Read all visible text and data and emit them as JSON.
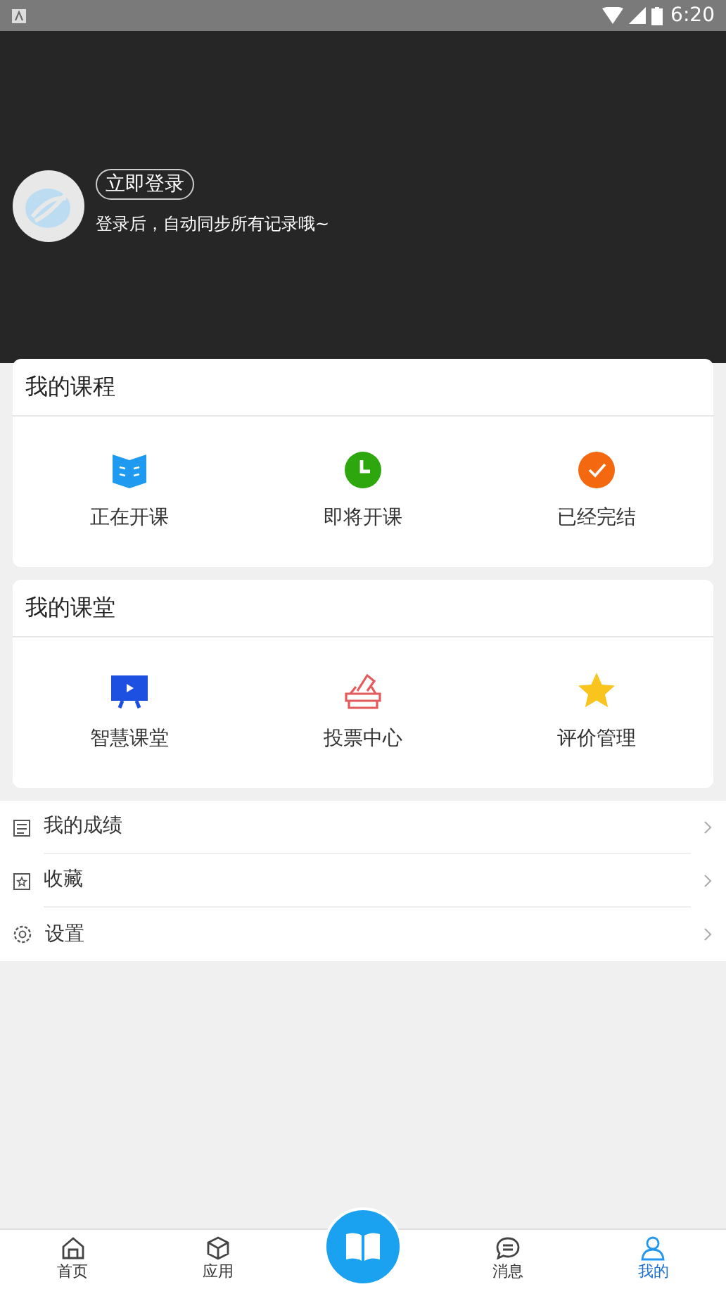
{
  "status_bar": {
    "time": "6:20"
  },
  "profile": {
    "login_button": "立即登录",
    "hint": "登录后，自动同步所有记录哦~"
  },
  "sections": [
    {
      "title": "我的课程",
      "items": [
        {
          "label": "正在开课",
          "kind": "book"
        },
        {
          "label": "即将开课",
          "kind": "clock"
        },
        {
          "label": "已经完结",
          "kind": "check"
        }
      ]
    },
    {
      "title": "我的课堂",
      "items": [
        {
          "label": "智慧课堂",
          "kind": "screen"
        },
        {
          "label": "投票中心",
          "kind": "vote"
        },
        {
          "label": "评价管理",
          "kind": "star"
        }
      ]
    }
  ],
  "menu": [
    {
      "label": "我的成绩",
      "kind": "report"
    },
    {
      "label": "收藏",
      "kind": "favorite"
    },
    {
      "label": "设置",
      "kind": "gear"
    }
  ],
  "bottom_nav": [
    {
      "kind": "tab",
      "label": "首页",
      "selected": false
    },
    {
      "kind": "tab",
      "label": "应用",
      "selected": false
    },
    {
      "kind": "center"
    },
    {
      "kind": "tab",
      "label": "消息",
      "selected": false
    },
    {
      "kind": "tab",
      "label": "我的",
      "selected": true
    }
  ]
}
